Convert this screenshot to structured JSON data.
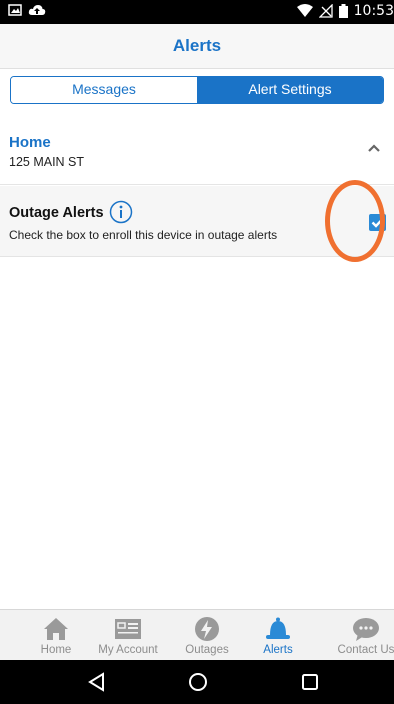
{
  "status": {
    "time": "10:53"
  },
  "header": {
    "title": "Alerts"
  },
  "tabs": [
    {
      "label": "Messages",
      "selected": false
    },
    {
      "label": "Alert Settings",
      "selected": true
    }
  ],
  "location": {
    "name": "Home",
    "address": "125 MAIN ST"
  },
  "outage_alerts": {
    "title": "Outage Alerts",
    "description": "Check the box to enroll this device in outage alerts",
    "checked": true
  },
  "bottom_nav": [
    {
      "label": "Home",
      "icon": "house-icon",
      "active": false
    },
    {
      "label": "My Account",
      "icon": "account-card-icon",
      "active": false
    },
    {
      "label": "Outages",
      "icon": "lightning-icon",
      "active": false
    },
    {
      "label": "Alerts",
      "icon": "bell-icon",
      "active": true
    },
    {
      "label": "Contact Us",
      "icon": "chat-bubble-icon",
      "active": false
    }
  ],
  "colors": {
    "accent": "#1a73c7",
    "highlight": "#f07030",
    "checkbox": "#2a8ad6"
  }
}
